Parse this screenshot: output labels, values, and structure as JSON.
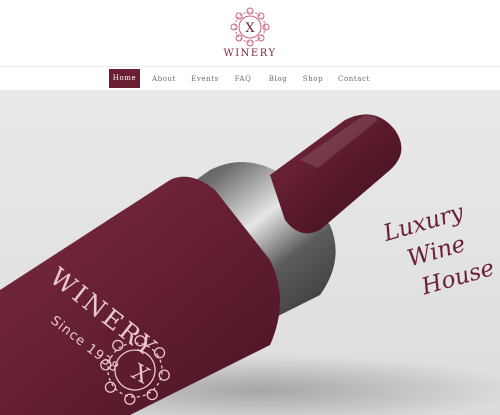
{
  "brand": {
    "name": "WINERY",
    "monogram": "X",
    "logo_icon": "ornamental-mandala-icon"
  },
  "nav": {
    "items": [
      {
        "label": "Home",
        "active": true
      },
      {
        "label": "About",
        "active": false
      },
      {
        "label": "Events",
        "active": false
      },
      {
        "label": "FAQ",
        "active": false
      },
      {
        "label": "Blog",
        "active": false
      },
      {
        "label": "Shop",
        "active": false
      },
      {
        "label": "Contact",
        "active": false
      }
    ]
  },
  "hero": {
    "tagline": [
      "Luxury",
      "Wine",
      "House"
    ],
    "bottle_label": {
      "monogram": "X",
      "name": "WINERY",
      "since": "Since 1938"
    }
  },
  "colors": {
    "accent": "#6b1f32",
    "label_text": "#e9c9cf",
    "background": "#e6e6e6"
  }
}
